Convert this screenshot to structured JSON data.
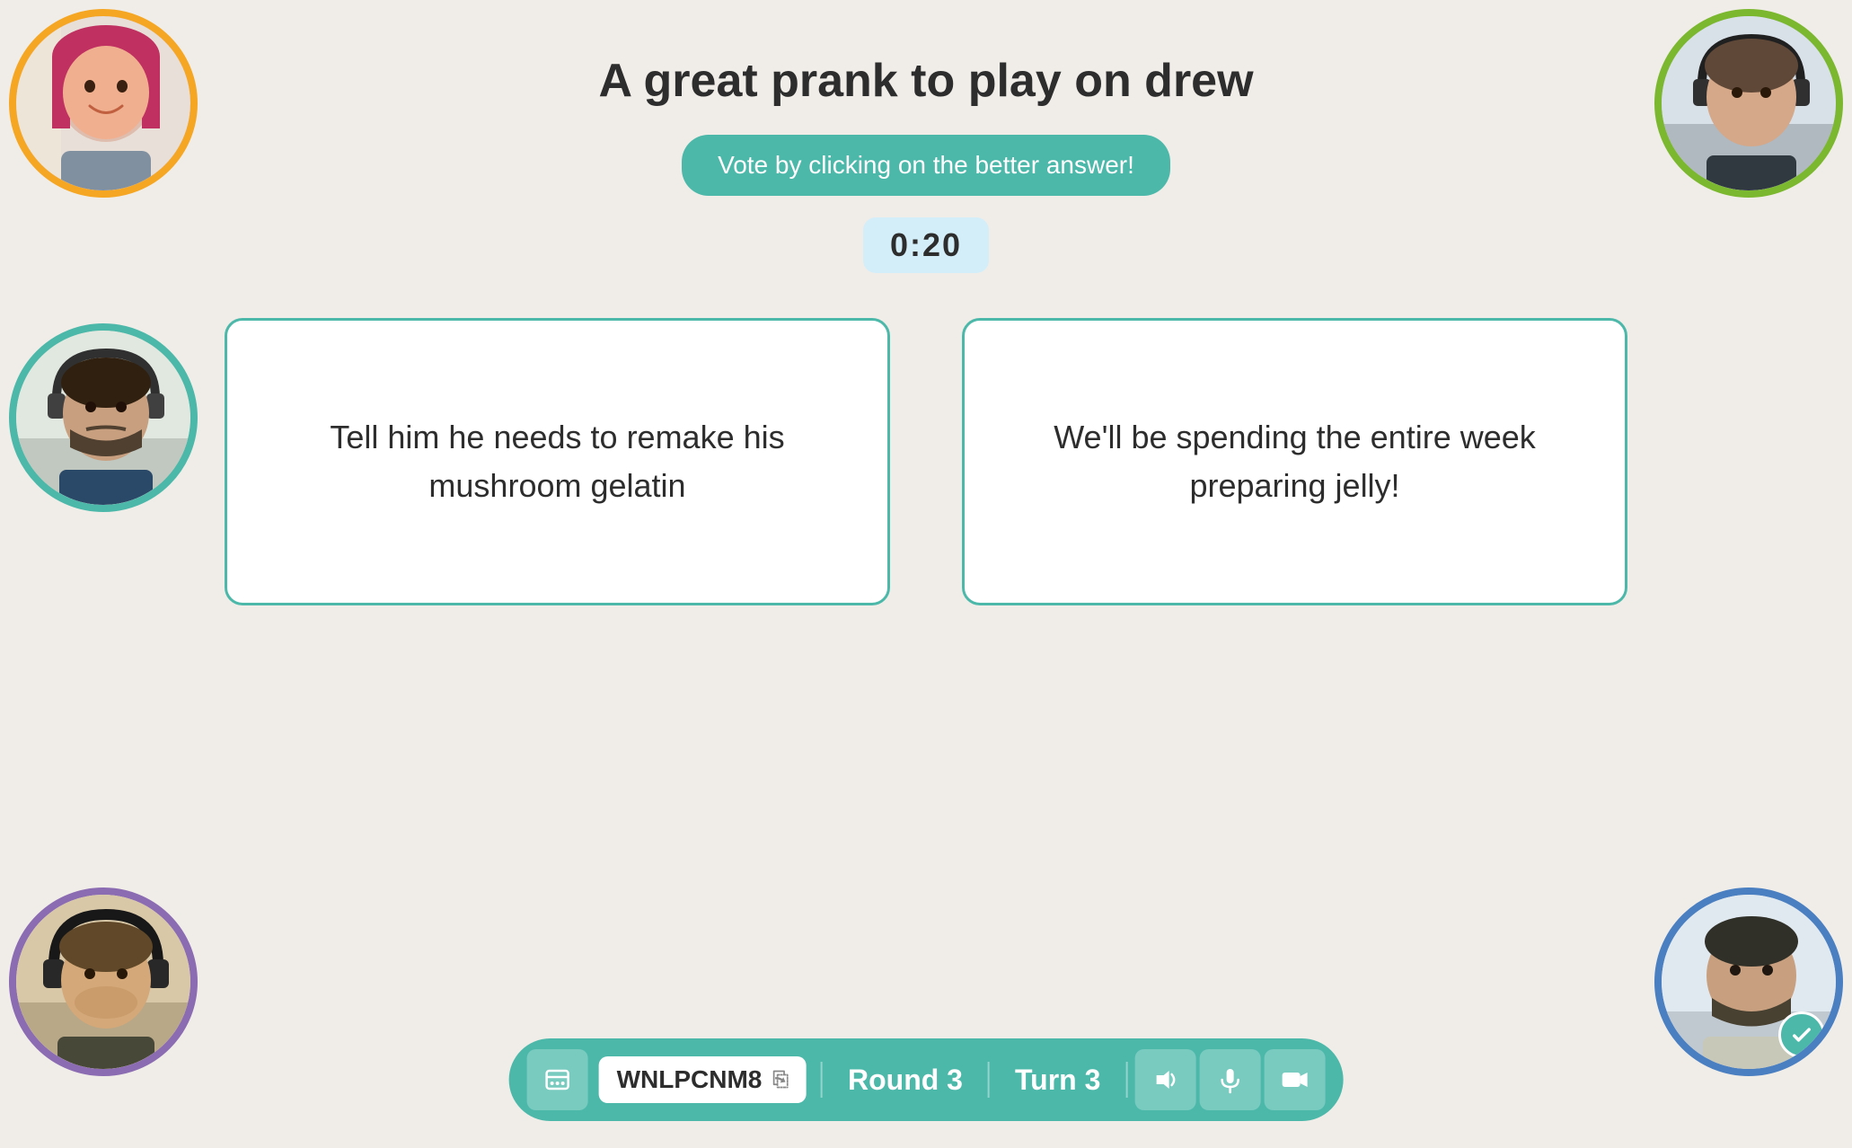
{
  "prompt": {
    "title": "A great prank to play on drew"
  },
  "vote_button": {
    "label": "Vote by clicking on the better answer!"
  },
  "timer": {
    "display": "0:20"
  },
  "answer_cards": [
    {
      "id": "card-1",
      "text": "Tell him he needs to remake his mushroom gelatin"
    },
    {
      "id": "card-2",
      "text": "We'll be spending the entire week preparing jelly!"
    }
  ],
  "avatars": [
    {
      "id": "player-1",
      "position": "top-left",
      "border_color": "#f5a623",
      "color_class": "person-1",
      "has_check": false
    },
    {
      "id": "player-2",
      "position": "top-right",
      "border_color": "#7cb82f",
      "color_class": "person-2",
      "has_check": false
    },
    {
      "id": "player-3",
      "position": "mid-left",
      "border_color": "#4cb8aa",
      "color_class": "person-3",
      "has_check": false
    },
    {
      "id": "player-4",
      "position": "bot-left",
      "border_color": "#8b6bb1",
      "color_class": "person-4",
      "has_check": false
    },
    {
      "id": "player-5",
      "position": "bot-right",
      "border_color": "#4a7fc1",
      "color_class": "person-5",
      "has_check": true
    }
  ],
  "toolbar": {
    "room_code": "WNLPCNM8",
    "round_label": "Round 3",
    "turn_label": "Turn 3"
  }
}
